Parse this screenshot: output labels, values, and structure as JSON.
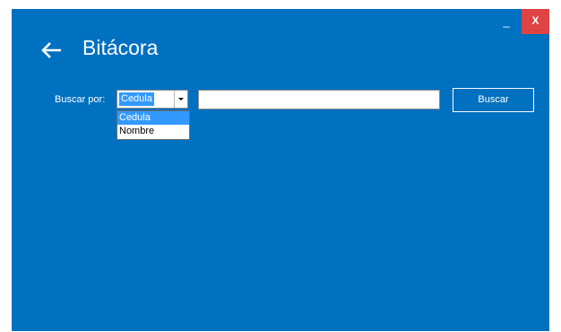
{
  "window": {
    "minimize_label": "_",
    "close_label": "X",
    "background_color": "#0070c0",
    "close_color": "#e04343"
  },
  "header": {
    "back_icon": "arrow-left-icon",
    "title": "Bitácora"
  },
  "search": {
    "label": "Buscar por:",
    "selected_value": "Cedula",
    "options": [
      "Cedula",
      "Nombre"
    ],
    "input_value": "",
    "button_label": "Buscar"
  }
}
